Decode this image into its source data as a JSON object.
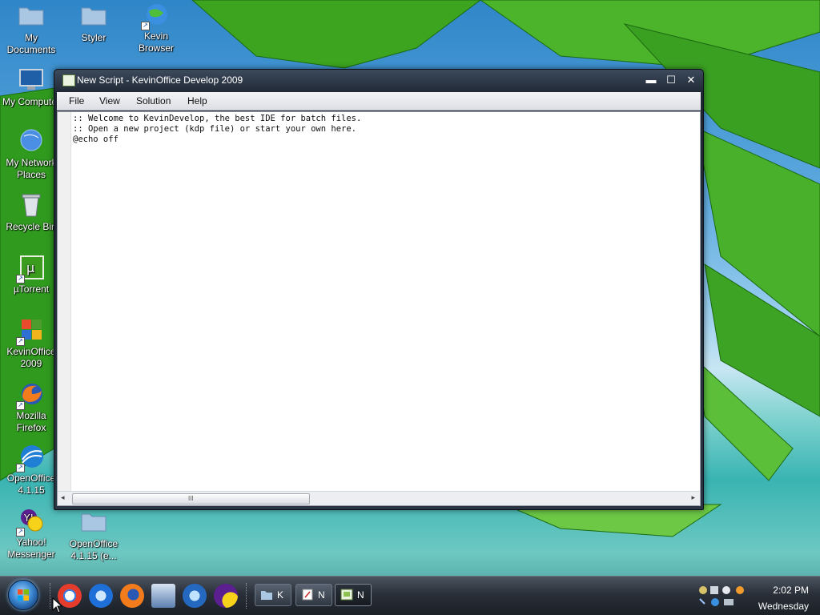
{
  "desktop": {
    "icons": [
      {
        "label": "My\nDocuments",
        "icon": "folder-icon"
      },
      {
        "label": "Styler",
        "icon": "folder-icon"
      },
      {
        "label": "Kevin\nBrowser",
        "icon": "globe-icon"
      },
      {
        "label": "My Computer",
        "icon": "monitor-icon"
      },
      {
        "label": "My Network\nPlaces",
        "icon": "network-globe-icon"
      },
      {
        "label": "Recycle Bin",
        "icon": "recycle-bin-icon"
      },
      {
        "label": "µTorrent",
        "icon": "utorrent-icon"
      },
      {
        "label": "KevinOffice\n2009",
        "icon": "kevinoffice-icon"
      },
      {
        "label": "Mozilla\nFirefox",
        "icon": "firefox-icon"
      },
      {
        "label": "OpenOffice\n4.1.15",
        "icon": "openoffice-icon"
      },
      {
        "label": "Yahoo!\nMessenger",
        "icon": "yahoo-messenger-icon"
      },
      {
        "label": "OpenOffice\n4.1.15 (e...",
        "icon": "folder-icon"
      }
    ]
  },
  "window": {
    "title": "New Script - KevinOffice Develop 2009",
    "buttons": {
      "minimize": "▬",
      "maximize": "☐",
      "close": "✕"
    },
    "menu": [
      "File",
      "View",
      "Solution",
      "Help"
    ],
    "editor_lines": [
      ":: Welcome to KevinDevelop, the best IDE for batch files.",
      ":: Open a new project (kdp file) or start your own here.",
      "@echo off"
    ],
    "scrollbar": {
      "left_arrow": "◂",
      "right_arrow": "▸",
      "grip": "III"
    }
  },
  "taskbar": {
    "quick_launch": [
      "chrome-icon",
      "internet-explorer-icon",
      "firefox-icon",
      "calculator-icon",
      "media-player-icon",
      "yahoo-messenger-icon"
    ],
    "tasks": [
      {
        "label": "K",
        "icon": "folder-icon",
        "active": false
      },
      {
        "label": "N",
        "icon": "notepad-icon",
        "active": false
      },
      {
        "label": "N",
        "icon": "kevinoffice-icon",
        "active": true
      }
    ],
    "clock": {
      "time": "2:02 PM",
      "day": "Wednesday"
    }
  }
}
